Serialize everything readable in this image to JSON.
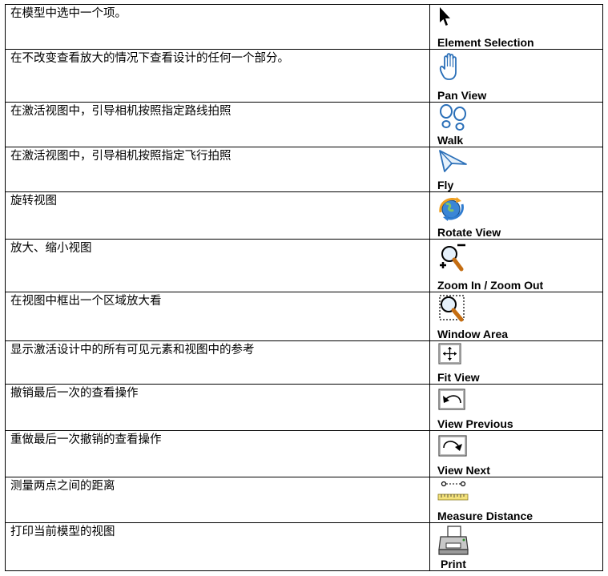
{
  "rows": [
    {
      "description": "在模型中选中一个项。",
      "tool_label": "Element Selection",
      "icon": "arrow-cursor-icon"
    },
    {
      "description": "在不改变查看放大的情况下查看设计的任何一个部分。",
      "tool_label": "Pan View",
      "icon": "hand-icon"
    },
    {
      "description": "在激活视图中，引导相机按照指定路线拍照",
      "tool_label": "Walk",
      "icon": "footprints-icon"
    },
    {
      "description": "在激活视图中，引导相机按照指定飞行拍照",
      "tool_label": "Fly",
      "icon": "paper-plane-icon"
    },
    {
      "description": "旋转视图",
      "tool_label": "Rotate View",
      "icon": "rotate-globe-icon"
    },
    {
      "description": "放大、缩小视图",
      "tool_label": "Zoom In / Zoom Out",
      "icon": "zoom-in-out-icon"
    },
    {
      "description": "在视图中框出一个区域放大看",
      "tool_label": "Window Area",
      "icon": "zoom-window-icon"
    },
    {
      "description": "显示激活设计中的所有可见元素和视图中的参考",
      "tool_label": "Fit View",
      "icon": "fit-view-icon"
    },
    {
      "description": "撤销最后一次的查看操作",
      "tool_label": "View Previous",
      "icon": "view-previous-icon"
    },
    {
      "description": "重做最后一次撤销的查看操作",
      "tool_label": "View Next",
      "icon": "view-next-icon"
    },
    {
      "description": "测量两点之间的距离",
      "tool_label": "Measure Distance",
      "icon": "measure-distance-icon"
    },
    {
      "description": "打印当前模型的视图",
      "tool_label": "Print",
      "icon": "printer-icon"
    }
  ]
}
